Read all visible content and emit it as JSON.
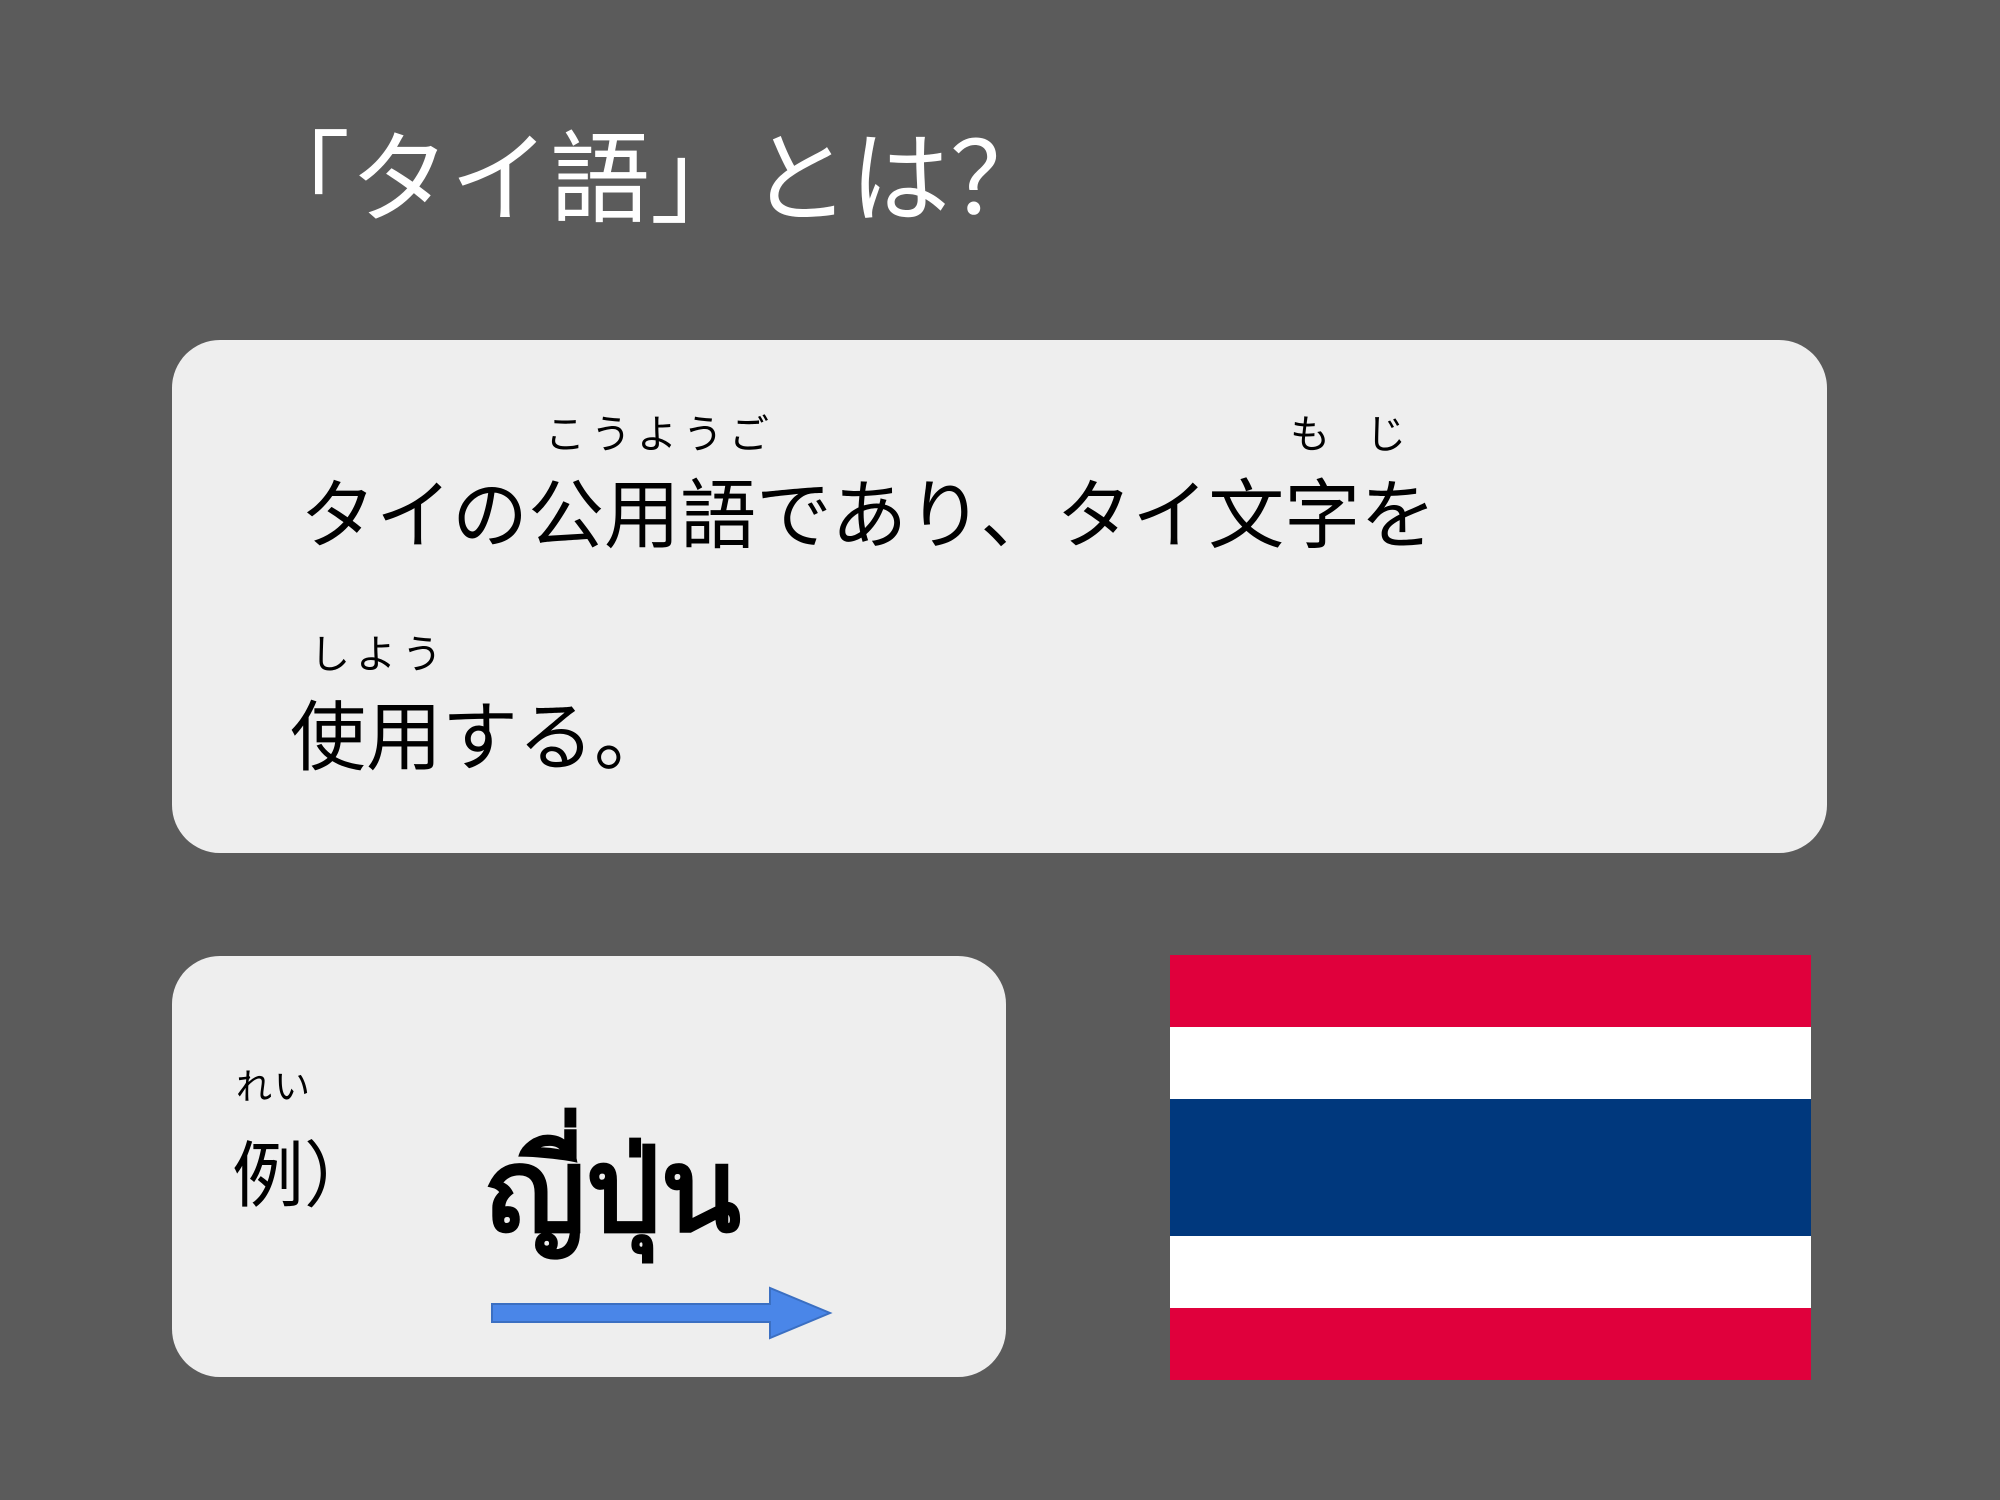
{
  "title": "「タイ語」とは？",
  "definition": {
    "line1": "タイの公用語であり、タイ文字を",
    "line2": "使用する。",
    "ruby": {
      "kouyougo": "こうようご",
      "moji": "もじ",
      "shiyou": "しよう"
    }
  },
  "example": {
    "ruby_rei": "れい",
    "label": "例）",
    "thai_word": "ญี่ปุ่น",
    "arrow_icon": "right-arrow-icon",
    "arrow_color": "#4a86e8"
  },
  "flag": {
    "icon": "thailand-flag-icon",
    "stripes": [
      "#e0003c",
      "#ffffff",
      "#00387d",
      "#ffffff",
      "#e0003c"
    ]
  }
}
